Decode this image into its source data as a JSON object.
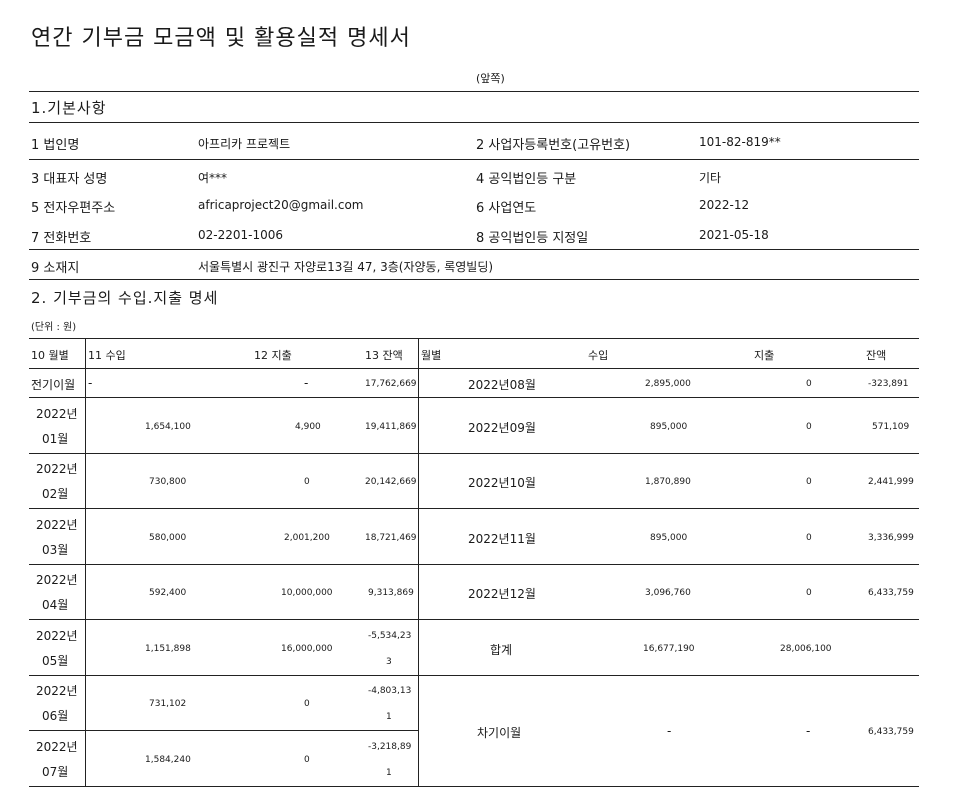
{
  "document": {
    "title": "연간 기부금 모금액 및 활용실적 명세서",
    "page_side": "(앞쪽)"
  },
  "section1": {
    "heading": "1.기본사항",
    "rows": [
      {
        "label_a": "1 법인명",
        "value_a": "아프리카 프로젝트",
        "label_b": "2 사업자등록번호(고유번호)",
        "value_b": "101-82-819**"
      },
      {
        "label_a": "3 대표자 성명",
        "value_a": "여***",
        "label_b": "4 공익법인등 구분",
        "value_b": "기타"
      },
      {
        "label_a": "5 전자우편주소",
        "value_a": "africaproject20@gmail.com",
        "label_b": "6 사업연도",
        "value_b": "2022-12"
      },
      {
        "label_a": "7 전화번호",
        "value_a": "02-2201-1006",
        "label_b": "8 공익법인등 지정일",
        "value_b": "2021-05-18"
      }
    ],
    "address_label": "9 소재지",
    "address_value": "서울특별시 광진구 자양로13길 47, 3층(자양동, 록영빌딩)"
  },
  "section2": {
    "heading": "2. 기부금의 수입.지출 명세",
    "unit": "(단위 : 원)",
    "left_headers": {
      "month": "10 월별",
      "income": "11 수입",
      "expense": "12 지출",
      "balance": "13 잔액"
    },
    "right_headers": {
      "month": "월별",
      "income": "수입",
      "expense": "지출",
      "balance": "잔액"
    },
    "carry_in": {
      "label": "전기이월",
      "income": "-",
      "expense": "-",
      "balance": "17,762,669"
    },
    "left_rows": [
      {
        "year": "2022년",
        "month": "01월",
        "income": "1,654,100",
        "expense": "4,900",
        "balance": "19,411,869"
      },
      {
        "year": "2022년",
        "month": "02월",
        "income": "730,800",
        "expense": "0",
        "balance": "20,142,669"
      },
      {
        "year": "2022년",
        "month": "03월",
        "income": "580,000",
        "expense": "2,001,200",
        "balance": "18,721,469"
      },
      {
        "year": "2022년",
        "month": "04월",
        "income": "592,400",
        "expense": "10,000,000",
        "balance": "9,313,869"
      },
      {
        "year": "2022년",
        "month": "05월",
        "income": "1,151,898",
        "expense": "16,000,000",
        "balance_l1": "-5,534,23",
        "balance_l2": "3"
      },
      {
        "year": "2022년",
        "month": "06월",
        "income": "731,102",
        "expense": "0",
        "balance_l1": "-4,803,13",
        "balance_l2": "1"
      },
      {
        "year": "2022년",
        "month": "07월",
        "income": "1,584,240",
        "expense": "0",
        "balance_l1": "-3,218,89",
        "balance_l2": "1"
      }
    ],
    "right_rows": [
      {
        "month": "2022년08월",
        "income": "2,895,000",
        "expense": "0",
        "balance": "-323,891"
      },
      {
        "month": "2022년09월",
        "income": "895,000",
        "expense": "0",
        "balance": "571,109"
      },
      {
        "month": "2022년10월",
        "income": "1,870,890",
        "expense": "0",
        "balance": "2,441,999"
      },
      {
        "month": "2022년11월",
        "income": "895,000",
        "expense": "0",
        "balance": "3,336,999"
      },
      {
        "month": "2022년12월",
        "income": "3,096,760",
        "expense": "0",
        "balance": "6,433,759"
      }
    ],
    "total": {
      "label": "합계",
      "income": "16,677,190",
      "expense": "28,006,100"
    },
    "carry_out": {
      "label": "차기이월",
      "income": "-",
      "expense": "-",
      "balance": "6,433,759"
    }
  }
}
